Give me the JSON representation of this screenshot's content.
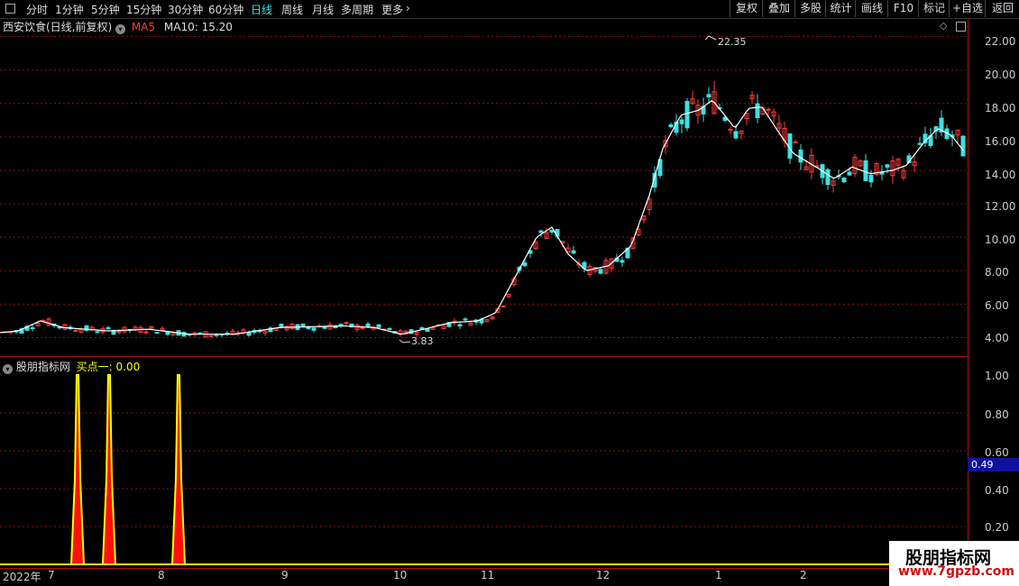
{
  "toolbar": {
    "timeframes": [
      {
        "label": "分时",
        "name": "tf-intraday"
      },
      {
        "label": "1分钟",
        "name": "tf-1min"
      },
      {
        "label": "5分钟",
        "name": "tf-5min"
      },
      {
        "label": "15分钟",
        "name": "tf-15min"
      },
      {
        "label": "30分钟",
        "name": "tf-30min"
      },
      {
        "label": "60分钟",
        "name": "tf-60min"
      },
      {
        "label": "日线",
        "name": "tf-daily",
        "active": true
      },
      {
        "label": "周线",
        "name": "tf-weekly"
      },
      {
        "label": "月线",
        "name": "tf-monthly"
      },
      {
        "label": "多周期",
        "name": "tf-multi"
      },
      {
        "label": "更多",
        "name": "tf-more"
      }
    ],
    "buttons": [
      "复权",
      "叠加",
      "多股",
      "统计",
      "画线",
      "F10",
      "标记",
      "+自选",
      "返回"
    ]
  },
  "main_panel": {
    "stock_title": "西安饮食(日线,前复权)",
    "ma5_label": "MA5",
    "ma10_label": "MA10: 15.20",
    "high_label": "22.35",
    "low_label": "3.83"
  },
  "indicator_panel": {
    "name": "股朋指标网",
    "series_label": "买点一: 0.00",
    "current_value": "0.49"
  },
  "watermark": {
    "line1": "股朋指标网",
    "line2": "www.7gpzb.com"
  },
  "colors": {
    "up": "#ff3b3b",
    "down": "#3fe0e0",
    "ma": "#ffffff",
    "grid": "#8a1010",
    "indicator_outline": "#ffff00",
    "indicator_fill": "#ff1010",
    "active_tab": "#3fe0e0"
  },
  "chart_data": [
    {
      "type": "line",
      "title": "西安饮食(日线,前复权)",
      "y_ticks": [
        "22.00",
        "20.00",
        "18.00",
        "16.00",
        "14.00",
        "12.00",
        "10.00",
        "8.00",
        "6.00",
        "4.00"
      ],
      "ylim": [
        3.0,
        23.0
      ],
      "x_ticks": [
        "2022年",
        "7",
        "8",
        "9",
        "10",
        "11",
        "12",
        "1",
        "2"
      ],
      "annotations": [
        {
          "text": "22.35",
          "value": 22.35
        },
        {
          "text": "3.83",
          "value": 3.83
        }
      ],
      "series": [
        {
          "name": "MA10",
          "x": [
            "2022-06",
            "2022-07",
            "2022-08",
            "2022-09",
            "2022-10",
            "2022-10-20",
            "2022-11",
            "2022-11-25",
            "2022-12",
            "2022-12-20",
            "2023-01",
            "2023-01-10",
            "2023-02",
            "2023-02-20",
            "2023-03"
          ],
          "values": [
            4.3,
            4.6,
            4.3,
            4.5,
            4.6,
            5.0,
            7.0,
            10.5,
            8.0,
            16.2,
            18.1,
            18.0,
            13.8,
            14.0,
            15.2
          ]
        }
      ]
    },
    {
      "type": "area",
      "title": "买点一",
      "y_ticks": [
        "1.00",
        "0.80",
        "0.60",
        "0.40",
        "0.20"
      ],
      "ylim": [
        0,
        1.0
      ],
      "series": [
        {
          "name": "买点一",
          "x": [
            "2022-07-07",
            "2022-07-17",
            "2022-08-05"
          ],
          "values": [
            1.0,
            1.0,
            1.0
          ]
        }
      ]
    }
  ]
}
